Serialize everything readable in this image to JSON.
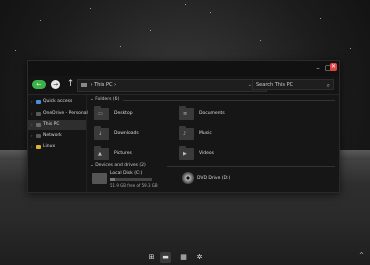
{
  "window": {
    "nav_back_label": "Back",
    "address_text": "This PC",
    "search_placeholder": "Search This PC"
  },
  "sidebar": {
    "items": [
      {
        "label": "Quick access",
        "icon": "star-icon",
        "color": "#4a8fd8"
      },
      {
        "label": "OneDrive - Personal",
        "icon": "cloud-icon",
        "color": "#5a5a5a"
      },
      {
        "label": "This PC",
        "icon": "computer-icon",
        "color": "#6a6a6a",
        "active": true
      },
      {
        "label": "Network",
        "icon": "network-icon",
        "color": "#5a5a5a"
      },
      {
        "label": "Linux",
        "icon": "linux-icon",
        "color": "#e0b030"
      }
    ]
  },
  "folders": {
    "header": "Folders (6)",
    "items": [
      {
        "label": "Desktop",
        "icon": "desktop-folder-icon"
      },
      {
        "label": "Documents",
        "icon": "documents-folder-icon"
      },
      {
        "label": "Downloads",
        "icon": "downloads-folder-icon"
      },
      {
        "label": "Music",
        "icon": "music-folder-icon"
      },
      {
        "label": "Pictures",
        "icon": "pictures-folder-icon"
      },
      {
        "label": "Videos",
        "icon": "videos-folder-icon"
      }
    ]
  },
  "drives": {
    "header": "Devices and drives (2)",
    "local_disk": {
      "label": "Local Disk (C:)",
      "free_text": "51.9 GB free of 59.3 GB",
      "used_fraction": 0.125
    },
    "dvd": {
      "label": "DVD Drive (D:)"
    }
  },
  "taskbar": {
    "icons": [
      "start-icon",
      "file-explorer-icon",
      "store-icon",
      "settings-icon"
    ],
    "tray": "^"
  },
  "colors": {
    "close": "#e34545",
    "back": "#3bb34a"
  }
}
